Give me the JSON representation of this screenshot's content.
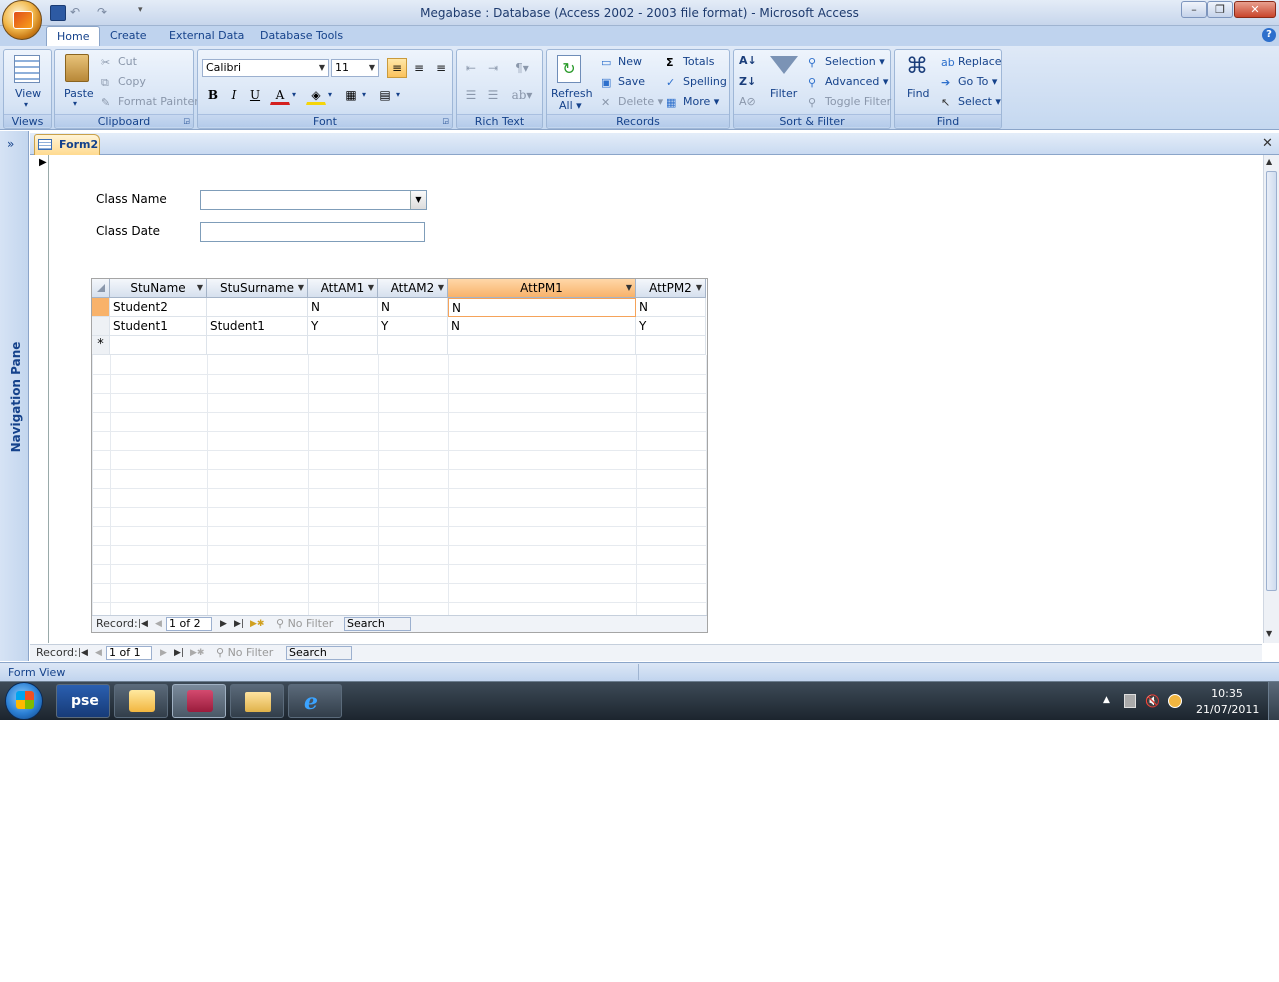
{
  "window": {
    "title": "Megabase : Database (Access 2002 - 2003 file format) - Microsoft Access"
  },
  "ribbon_tabs": [
    "Home",
    "Create",
    "External Data",
    "Database Tools"
  ],
  "ribbon": {
    "views": {
      "label": "Views",
      "view": "View"
    },
    "clipboard": {
      "label": "Clipboard",
      "paste": "Paste",
      "cut": "Cut",
      "copy": "Copy",
      "format_painter": "Format Painter"
    },
    "font": {
      "label": "Font",
      "family": "Calibri",
      "size": "11",
      "bold": "B",
      "italic": "I",
      "underline": "U",
      "font_color": "A"
    },
    "rich_text": {
      "label": "Rich Text"
    },
    "records": {
      "label": "Records",
      "refresh": "Refresh",
      "refresh_all": "All",
      "new": "New",
      "save": "Save",
      "delete": "Delete",
      "totals": "Totals",
      "spelling": "Spelling",
      "more": "More"
    },
    "sort_filter": {
      "label": "Sort & Filter",
      "filter": "Filter",
      "selection": "Selection",
      "advanced": "Advanced",
      "toggle_filter": "Toggle Filter"
    },
    "find": {
      "label": "Find",
      "find": "Find",
      "replace": "Replace",
      "goto": "Go To",
      "select": "Select"
    }
  },
  "navigation_pane": {
    "label": "Navigation Pane",
    "toggle": "»"
  },
  "document_tab": {
    "label": "Form2"
  },
  "form": {
    "class_name_label": "Class Name",
    "class_name_value": "",
    "class_date_label": "Class Date",
    "class_date_value": ""
  },
  "datasheet": {
    "columns": [
      "StuName",
      "StuSurname",
      "AttAM1",
      "AttAM2",
      "AttPM1",
      "AttPM2"
    ],
    "selected_column": "AttPM1",
    "rows": [
      [
        "Student2",
        "",
        "N",
        "N",
        "N",
        "N"
      ],
      [
        "Student1",
        "Student1",
        "Y",
        "Y",
        "N",
        "Y"
      ]
    ],
    "new_row_marker": "*",
    "nav": {
      "record_label": "Record:",
      "position": "1 of 2",
      "filter": "No Filter",
      "search": "Search"
    }
  },
  "form_nav": {
    "record_label": "Record:",
    "position": "1 of 1",
    "filter": "No Filter",
    "search": "Search"
  },
  "status_bar": {
    "text": "Form View"
  },
  "taskbar": {
    "apps": [
      "pse"
    ],
    "clock_time": "10:35",
    "clock_date": "21/07/2011"
  },
  "colors": {
    "accent_orange": "#f8b26a",
    "ribbon_blue": "#c5d8f0",
    "text_blue": "#15428b"
  }
}
